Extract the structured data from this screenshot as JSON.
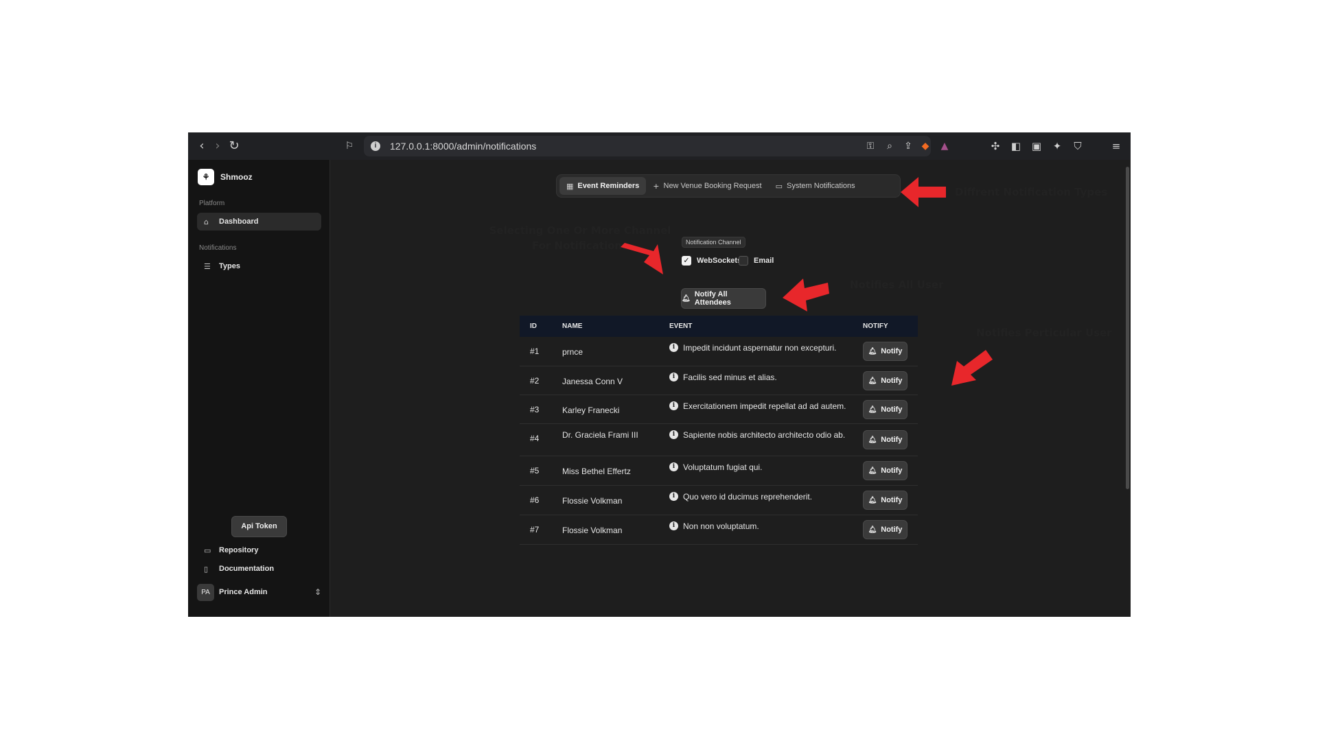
{
  "browser": {
    "url": "127.0.0.1:8000/admin/notifications",
    "icons": [
      "back-icon",
      "forward-icon",
      "reload-icon",
      "bookmark-icon",
      "info-icon",
      "key-icon",
      "zoom-icon",
      "share-icon",
      "brave-shield-icon",
      "brave-rewards-icon",
      "extensions-icon",
      "sidebar-icon",
      "wallet-icon",
      "leo-icon",
      "vpn-icon",
      "menu-icon"
    ]
  },
  "sidebar": {
    "app_name": "Shmooz",
    "section_platform": "Platform",
    "dashboard_label": "Dashboard",
    "section_notifications": "Notifications",
    "types_label": "Types",
    "api_token_label": "Api Token",
    "repository_label": "Repository",
    "documentation_label": "Documentation",
    "user_initials": "PA",
    "user_name": "Prince Admin"
  },
  "tabs": [
    {
      "label": "Event Reminders",
      "active": true
    },
    {
      "label": "New Venue Booking Request",
      "active": false
    },
    {
      "label": "System Notifications",
      "active": false
    }
  ],
  "channel": {
    "badge": "Notification Channel",
    "options": [
      {
        "label": "WebSockets",
        "checked": true
      },
      {
        "label": "Email",
        "checked": false
      }
    ]
  },
  "notify_all_label": "Notify All Attendees",
  "table": {
    "headers": [
      "ID",
      "NAME",
      "EVENT",
      "NOTIFY"
    ],
    "notify_label": "Notify",
    "rows": [
      {
        "id": "#1",
        "name": "prnce",
        "event": "Impedit incidunt aspernatur non excepturi."
      },
      {
        "id": "#2",
        "name": "Janessa Conn V",
        "event": "Facilis sed minus et alias."
      },
      {
        "id": "#3",
        "name": "Karley Franecki",
        "event": "Exercitationem impedit repellat ad ad autem."
      },
      {
        "id": "#4",
        "name": "Dr. Graciela Frami III",
        "event": "Sapiente nobis architecto architecto odio ab."
      },
      {
        "id": "#5",
        "name": "Miss Bethel Effertz",
        "event": "Voluptatum fugiat qui."
      },
      {
        "id": "#6",
        "name": "Flossie Volkman",
        "event": "Quo vero id ducimus reprehenderit."
      },
      {
        "id": "#7",
        "name": "Flossie Volkman",
        "event": "Non non voluptatum."
      }
    ]
  },
  "annotations": {
    "types": "Diffrent Notification Types",
    "channel": "Selecting One Or More Channel For Notifications",
    "notify_all": "Notifies All User",
    "notify_user": "Notifies Perticular User"
  },
  "colors": {
    "arrow": "#e8272b",
    "page_bg": "#1e1e1e",
    "sidebar_bg": "#141414",
    "table_header": "#111827"
  }
}
